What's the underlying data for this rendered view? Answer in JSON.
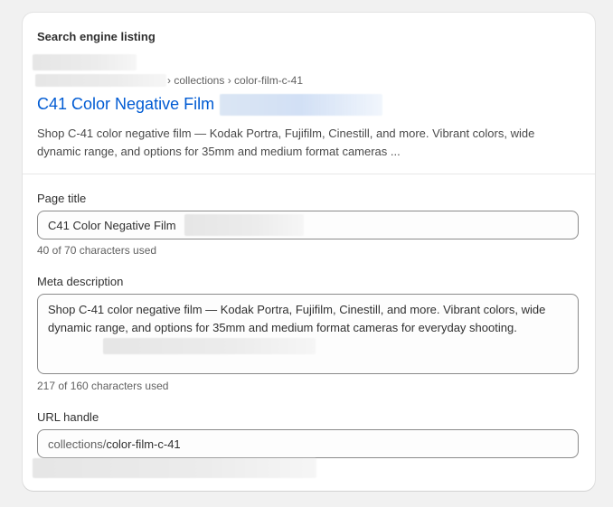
{
  "seo": {
    "section_title": "Search engine listing",
    "preview": {
      "breadcrumb": "› collections › color-film-c-41",
      "title": "C41 Color Negative Film",
      "description": "Shop C-41 color negative film — Kodak Portra, Fujifilm, Cinestill, and more. Vibrant colors, wide dynamic range, and options for 35mm and medium format cameras ..."
    },
    "page_title": {
      "label": "Page title",
      "value": "C41 Color Negative Film",
      "counter": "40 of 70 characters used"
    },
    "meta_description": {
      "label": "Meta description",
      "value": "Shop C-41 color negative film — Kodak Portra, Fujifilm, Cinestill, and more. Vibrant colors, wide dynamic range, and options for 35mm and medium format cameras for everyday shooting.",
      "counter": "217 of 160 characters used"
    },
    "url_handle": {
      "label": "URL handle",
      "prefix": "collections/",
      "value": "color-film-c-41"
    }
  }
}
